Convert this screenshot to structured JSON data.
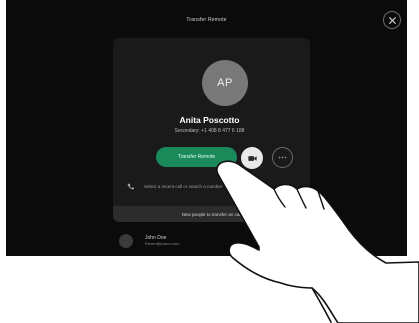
{
  "header": {
    "title": "Transfer Remote"
  },
  "contact": {
    "initials": "AP",
    "name": "Anita Poscotto",
    "detail": "Secondary: +1 408 8 477 6 188"
  },
  "actions": {
    "transfer_label": "Transfer Remote"
  },
  "hint": {
    "text": "Select a recent call or search a number"
  },
  "new_call": {
    "label": "New people to transfer an call"
  },
  "recent": {
    "name": "John Doe",
    "detail": "Recent@cisco.com"
  },
  "colors": {
    "accent": "#1b8a5a",
    "background": "#0b0b0b",
    "card": "#1a1a1a"
  }
}
